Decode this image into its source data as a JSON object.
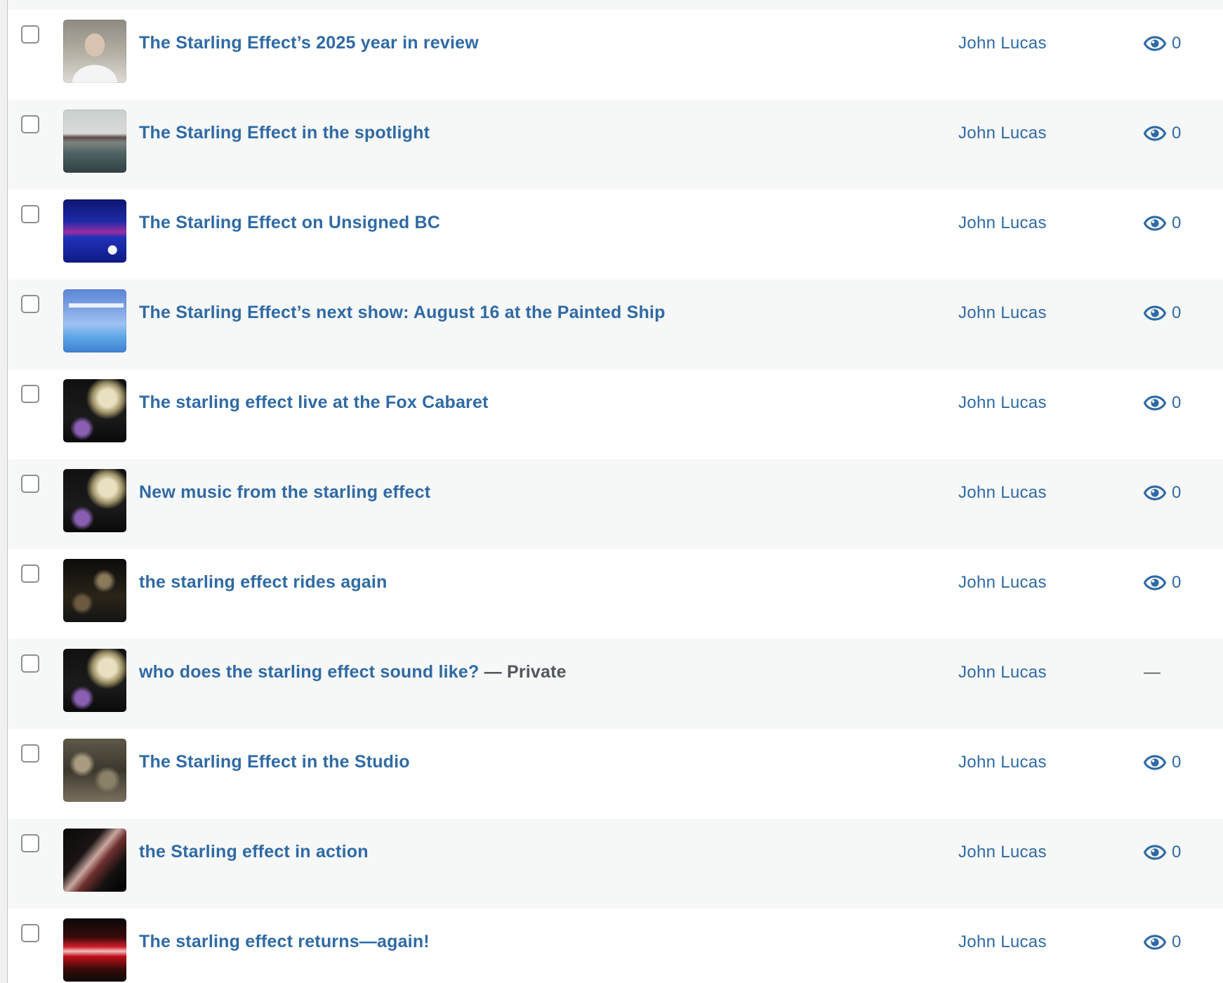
{
  "posts": [
    {
      "title": "The Starling Effect’s 2025 year in review",
      "state": "",
      "author": "John Lucas",
      "views": "0",
      "thumb": "portrait"
    },
    {
      "title": "The Starling Effect in the spotlight",
      "state": "",
      "author": "John Lucas",
      "views": "0",
      "thumb": "field"
    },
    {
      "title": "The Starling Effect on Unsigned BC",
      "state": "",
      "author": "John Lucas",
      "views": "0",
      "thumb": "blue-wave"
    },
    {
      "title": "The Starling Effect’s next show: August 16 at the Painted Ship",
      "state": "",
      "author": "John Lucas",
      "views": "0",
      "thumb": "poster"
    },
    {
      "title": "The starling effect live at the Fox Cabaret",
      "state": "",
      "author": "John Lucas",
      "views": "0",
      "thumb": "live"
    },
    {
      "title": "New music from the starling effect",
      "state": "",
      "author": "John Lucas",
      "views": "0",
      "thumb": "live"
    },
    {
      "title": "the starling effect rides again",
      "state": "",
      "author": "John Lucas",
      "views": "0",
      "thumb": "stage"
    },
    {
      "title": "who does the starling effect sound like?",
      "state": " — Private",
      "author": "John Lucas",
      "views": "—",
      "thumb": "live"
    },
    {
      "title": "The Starling Effect in the Studio",
      "state": "",
      "author": "John Lucas",
      "views": "0",
      "thumb": "studio"
    },
    {
      "title": "the Starling effect in action",
      "state": "",
      "author": "John Lucas",
      "views": "0",
      "thumb": "guitar"
    },
    {
      "title": "The starling effect returns—again!",
      "state": "",
      "author": "John Lucas",
      "views": "0",
      "thumb": "red"
    }
  ],
  "colors": {
    "link": "#2f6aa4",
    "row_alt": "#f6f7f7",
    "row": "#ffffff",
    "muted_text": "#50575e"
  },
  "icons": {
    "views": "eye-icon"
  }
}
